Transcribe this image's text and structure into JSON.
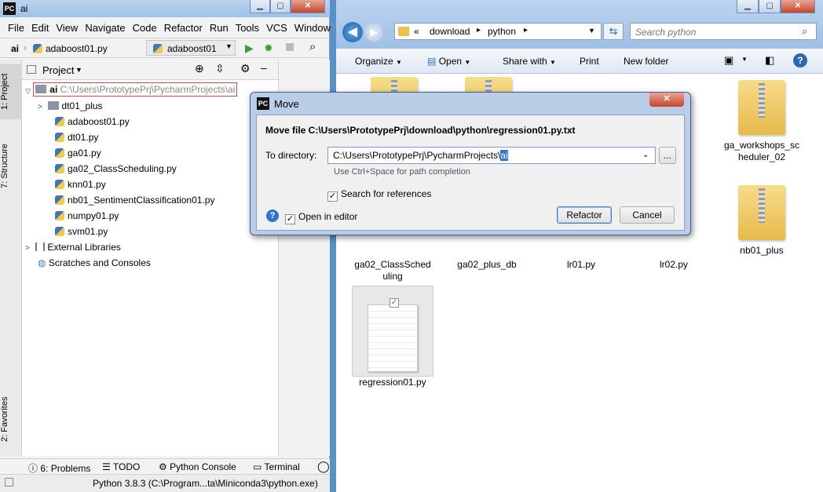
{
  "pycharm": {
    "title": "ai",
    "menu": [
      "File",
      "Edit",
      "View",
      "Navigate",
      "Code",
      "Refactor",
      "Run",
      "Tools",
      "VCS",
      "Window"
    ],
    "nav": {
      "project": "ai",
      "file": "adaboost01.py",
      "run_config": "adaboost01"
    },
    "panel_title": "Project",
    "tree": {
      "root_name": "ai",
      "root_path": "C:\\Users\\PrototypePrj\\PycharmProjects\\ai",
      "items": [
        "dt01_plus",
        "adaboost01.py",
        "dt01.py",
        "ga01.py",
        "ga02_ClassScheduling.py",
        "knn01.py",
        "nb01_SentimentClassification01.py",
        "numpy01.py",
        "svm01.py"
      ],
      "external": "External Libraries",
      "scratches": "Scratches and Consoles"
    },
    "side_tabs": {
      "project": "1: Project",
      "structure": "7: Structure",
      "favorites": "2: Favorites"
    },
    "bottom_tabs": [
      "6: Problems",
      "TODO",
      "Python Console",
      "Terminal"
    ],
    "status": "Python 3.8.3 (C:\\Program...ta\\Miniconda3\\python.exe)"
  },
  "explorer": {
    "path": [
      "«",
      "download",
      "python"
    ],
    "search_placeholder": "Search python",
    "toolbar": [
      "Organize",
      "Open",
      "Share with",
      "Print",
      "New folder"
    ],
    "tiles": [
      {
        "label": "ga_workshops_sc heduler_02"
      },
      {
        "label": "nb01_plus"
      },
      {
        "label": "ga02_ClassSched uling"
      },
      {
        "label": "ga02_plus_db"
      },
      {
        "label": "lr01.py"
      },
      {
        "label": "lr02.py"
      },
      {
        "label": "regression01.py"
      }
    ],
    "partial_label_1": "s_sc",
    "partial_label_2": "1"
  },
  "dialog": {
    "title": "Move",
    "heading": "Move file C:\\Users\\PrototypePrj\\download\\python\\regression01.py.txt",
    "to_dir_label": "To directory:",
    "dir_prefix": "C:\\Users\\PrototypePrj\\PycharmProjects\\",
    "dir_selected": "ai",
    "browse": "...",
    "hint": "Use Ctrl+Space for path completion",
    "search_refs": "Search for references",
    "open_editor": "Open in editor",
    "refactor": "Refactor",
    "cancel": "Cancel",
    "help": "?"
  }
}
